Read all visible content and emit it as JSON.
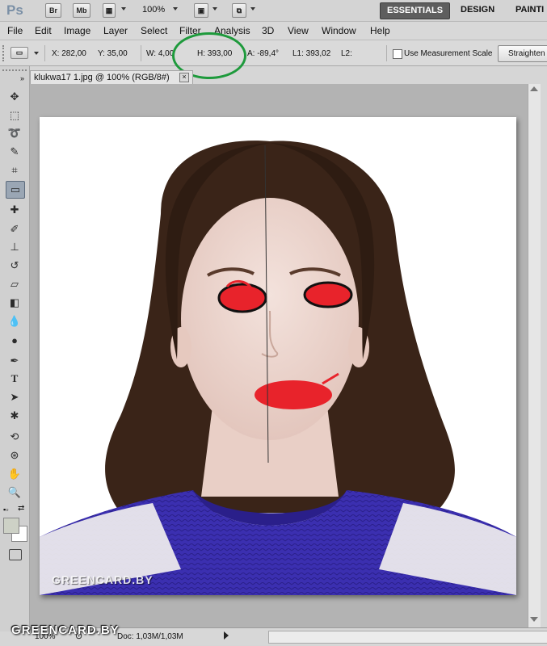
{
  "app": {
    "logo": "Ps",
    "bridge_label": "Br",
    "minibridge_label": "Mb",
    "zoom": "100%",
    "workspaces": [
      "ESSENTIALS",
      "DESIGN",
      "PAINTI"
    ]
  },
  "menu": [
    "File",
    "Edit",
    "Image",
    "Layer",
    "Select",
    "Filter",
    "Analysis",
    "3D",
    "View",
    "Window",
    "Help"
  ],
  "options": {
    "x": "X: 282,00",
    "y": "Y: 35,00",
    "w": "W: 4,00",
    "h": "H: 393,00",
    "a": "A: -89,4°",
    "l1": "L1: 393,02",
    "l2": "L2:",
    "measurement_scale_label": "Use Measurement Scale",
    "straighten_label": "Straighten"
  },
  "document": {
    "tab_title": "klukwa17 1.jpg @ 100% (RGB/8#)",
    "close_glyph": "×"
  },
  "status": {
    "zoom": "100%",
    "doc": "Doc: 1,03M/1,03M"
  },
  "watermark": {
    "photo": "GREENCARD.BY",
    "bottom": "GREENCARD.BY"
  },
  "colors": {
    "annotation_green": "#1e9a3c",
    "red_marker": "#e8232b",
    "sweater_blue": "#3b2fb0",
    "hair": "#3a2418"
  },
  "tools": [
    "move-icon",
    "marquee-icon",
    "lasso-icon",
    "quick-select-icon",
    "crop-icon",
    "ruler-icon",
    "healing-brush-icon",
    "brush-icon",
    "clone-stamp-icon",
    "history-brush-icon",
    "eraser-icon",
    "paint-bucket-icon",
    "blur-icon",
    "dodge-icon",
    "pen-icon",
    "type-icon",
    "path-select-icon",
    "shape-icon",
    "3d-rotate-icon",
    "3d-orbit-icon",
    "hand-icon",
    "zoom-icon"
  ]
}
